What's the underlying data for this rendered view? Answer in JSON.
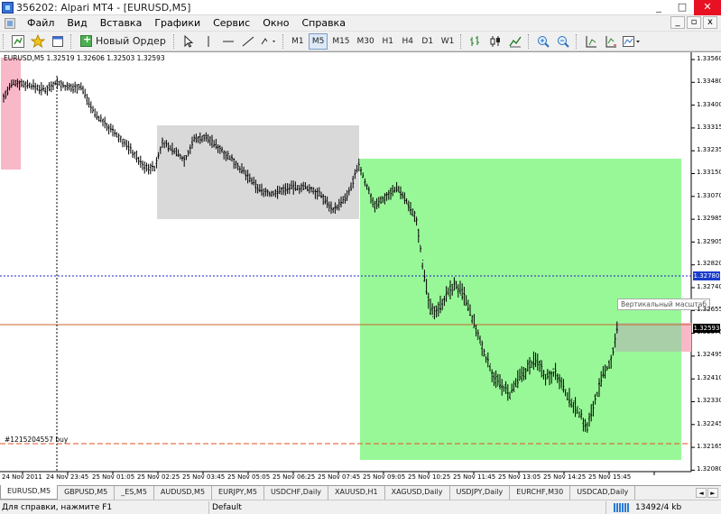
{
  "window": {
    "title": "356202: Alpari MT4 - [EURUSD,M5]",
    "controls": [
      "_",
      "□",
      "✕"
    ]
  },
  "menu": {
    "items": [
      "Файл",
      "Вид",
      "Вставка",
      "Графики",
      "Сервис",
      "Окно",
      "Справка"
    ],
    "mdi_controls": [
      "_",
      "▫",
      "x"
    ]
  },
  "toolbar": {
    "new_order_label": "Новый Ордер",
    "timeframes": [
      "M1",
      "M5",
      "M15",
      "M30",
      "H1",
      "H4",
      "D1",
      "W1"
    ],
    "active_timeframe": "M5"
  },
  "chart": {
    "symbol_info": "EURUSD,M5  1.32519 1.32606 1.32503 1.32593",
    "order_label": "#1215204557 buy",
    "vscale_tooltip": "Вертикальный масштаб",
    "price_ticks": [
      "1.33560",
      "1.33480",
      "1.33400",
      "1.33315",
      "1.33235",
      "1.33150",
      "1.33070",
      "1.32985",
      "1.32905",
      "1.32820",
      "1.32740",
      "1.32655",
      "1.32575",
      "1.32495",
      "1.32410",
      "1.32330",
      "1.32245",
      "1.32165",
      "1.32080"
    ],
    "blue_line_price": "1.32780",
    "current_price": "1.32593",
    "time_ticks": [
      "24 Nov 2011",
      "24 Nov 23:45",
      "25 Nov 01:05",
      "25 Nov 02:25",
      "25 Nov 03:45",
      "25 Nov 05:05",
      "25 Nov 06:25",
      "25 Nov 07:45",
      "25 Nov 09:05",
      "25 Nov 10:25",
      "25 Nov 11:45",
      "25 Nov 13:05",
      "25 Nov 14:25",
      "25 Nov 15:45"
    ],
    "colors": {
      "background": "#ffffff",
      "bars": "#000000",
      "grey_zone": "#d9d9d9",
      "green_zone": "#98f898",
      "pink_zone": "#f8b8c8",
      "bid_line": "#c86428",
      "blue_level": "#2020c8",
      "order_line": "#e05020",
      "price_tag_current": "#000000",
      "price_tag_blue": "#1a3ccc"
    }
  },
  "tabs": {
    "items": [
      "EURUSD,M5",
      "GBPUSD,M5",
      "_ES,M5",
      "AUDUSD,M5",
      "EURJPY,M5",
      "USDCHF,Daily",
      "XAUUSD,H1",
      "XAGUSD,Daily",
      "USDJPY,Daily",
      "EURCHF,M30",
      "USDCAD,Daily"
    ],
    "active": "EURUSD,M5",
    "arrows": [
      "◄",
      "►"
    ]
  },
  "status": {
    "help": "Для справки, нажмите F1",
    "profile": "Default",
    "traffic": "13492/4 kb"
  }
}
